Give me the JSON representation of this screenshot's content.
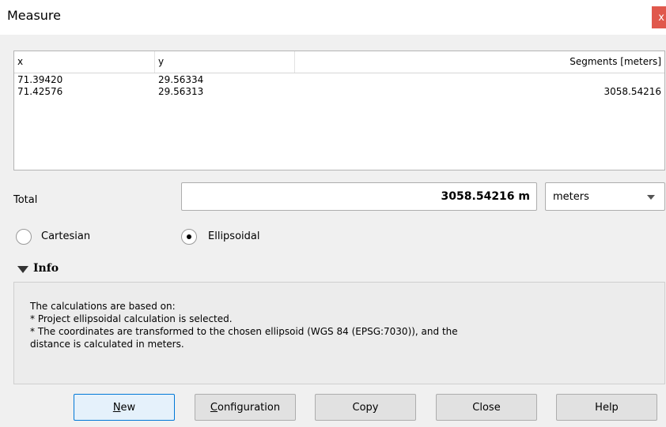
{
  "window": {
    "title": "Measure",
    "close_glyph": "x"
  },
  "table": {
    "headers": {
      "x": "x",
      "y": "y",
      "segments": "Segments [meters]"
    },
    "rows": [
      {
        "x": "71.39420",
        "y": "29.56334",
        "segment": ""
      },
      {
        "x": "71.42576",
        "y": "29.56313",
        "segment": "3058.54216"
      }
    ]
  },
  "total": {
    "label": "Total",
    "value": "3058.54216 m",
    "unit_selected": "meters"
  },
  "mode": {
    "cartesian_label": "Cartesian",
    "ellipsoidal_label": "Ellipsoidal",
    "selected": "Ellipsoidal"
  },
  "info": {
    "title": "Info",
    "lines": [
      "The calculations are based on:",
      "* Project ellipsoidal calculation is selected.",
      "* The coordinates are transformed to the chosen ellipsoid (WGS 84 (EPSG:7030)), and the",
      "distance is calculated in meters."
    ]
  },
  "buttons": {
    "new_first": "N",
    "new_rest": "ew",
    "config_first": "C",
    "config_rest": "onfiguration",
    "copy": "Copy",
    "close": "Close",
    "help": "Help"
  },
  "colors": {
    "window_bg": "#f0f0f0",
    "close_red": "#e0584c",
    "default_button_border": "#0078d7"
  }
}
